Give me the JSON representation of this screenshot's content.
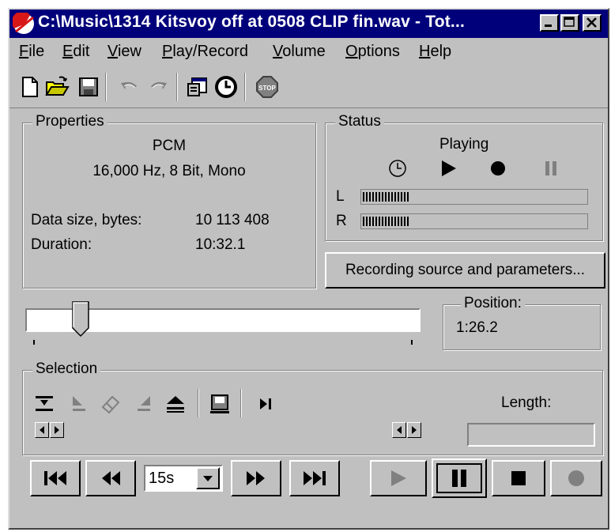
{
  "window": {
    "title": "C:\\Music\\1314 Kitsvoy off at 0508 CLIP fin.wav - Tot..."
  },
  "menu": [
    {
      "label": "File",
      "hot": "F",
      "rest": "ile"
    },
    {
      "label": "Edit",
      "hot": "E",
      "rest": "dit"
    },
    {
      "label": "View",
      "hot": "V",
      "rest": "iew"
    },
    {
      "label": "Play/Record",
      "hot": "P",
      "rest": "lay/Record"
    },
    {
      "label": "Volume",
      "hot": "V",
      "rest": "olume"
    },
    {
      "label": "Options",
      "hot": "O",
      "rest": "ptions"
    },
    {
      "label": "Help",
      "hot": "H",
      "rest": "elp"
    }
  ],
  "toolbar": {
    "icons": [
      "new-file-icon",
      "open-folder-icon",
      "save-disk-icon",
      "undo-icon",
      "redo-icon",
      "properties-icon",
      "clock-icon",
      "stop-sign-icon"
    ],
    "stop_sign_text": "STOP"
  },
  "properties": {
    "label": "Properties",
    "format": "PCM",
    "spec": "16,000 Hz, 8 Bit, Mono",
    "data_size_label": "Data size, bytes:",
    "data_size_value": "10 113 408",
    "duration_label": "Duration:",
    "duration_value": "10:32.1"
  },
  "status": {
    "label": "Status",
    "state": "Playing",
    "indicators": [
      "clock-icon",
      "play-icon",
      "record-dot-icon",
      "pause-icon"
    ],
    "active_indicator": "play-icon",
    "left_channel": "L",
    "right_channel": "R",
    "left_level": 0.21,
    "right_level": 0.21
  },
  "recording_source_button": "Recording source and parameters...",
  "position": {
    "label": "Position:",
    "value": "1:26.2",
    "slider_fraction": 0.14
  },
  "selection": {
    "label": "Selection",
    "icons": [
      "mark-start-icon",
      "set-start-icon",
      "eraser-icon",
      "set-end-icon",
      "eject-icon",
      "save-selection-icon",
      "jump-end-icon"
    ],
    "length_label": "Length:",
    "length_value": ""
  },
  "transport": {
    "skip_interval": "15s",
    "buttons": [
      "skip-to-start",
      "rewind",
      "fast-forward",
      "skip-to-end",
      "play",
      "pause",
      "stop",
      "record"
    ],
    "active": "pause"
  },
  "colors": {
    "title_bar": "#00007b",
    "face": "#c0c0c0",
    "record_dot": "#808080"
  }
}
